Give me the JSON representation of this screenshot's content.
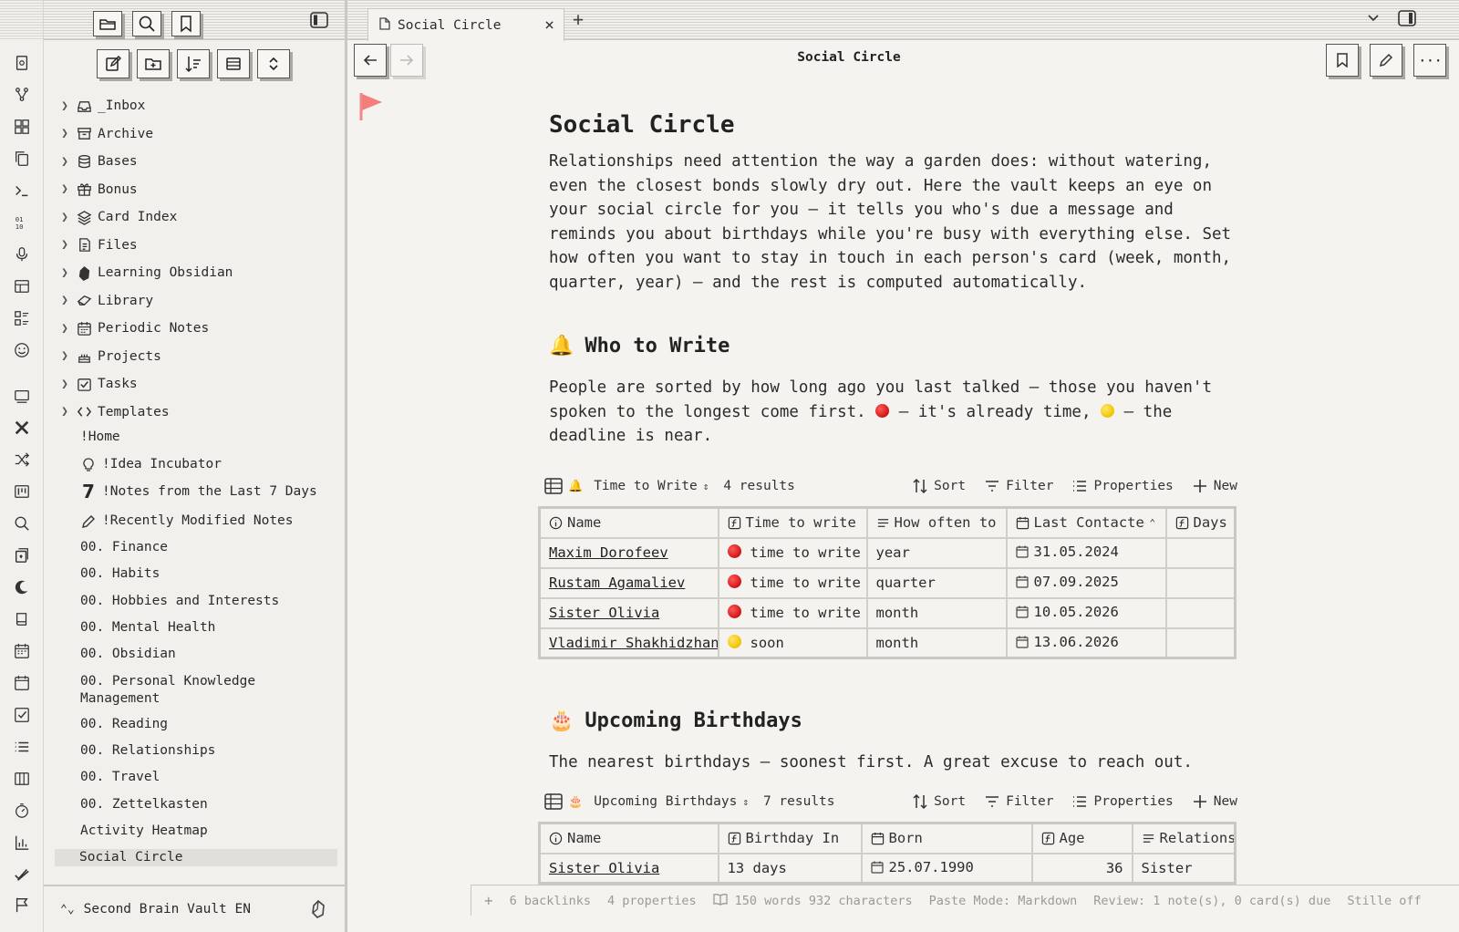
{
  "sidebar": {
    "tree": [
      {
        "label": "_Inbox",
        "icon": "inbox-icon"
      },
      {
        "label": "Archive",
        "icon": "archive-icon"
      },
      {
        "label": "Bases",
        "icon": "database-icon"
      },
      {
        "label": "Bonus",
        "icon": "gift-icon"
      },
      {
        "label": "Card Index",
        "icon": "layers-icon"
      },
      {
        "label": "Files",
        "icon": "files-icon"
      },
      {
        "label": "Learning Obsidian",
        "icon": "obsidian-icon"
      },
      {
        "label": "Library",
        "icon": "book-icon"
      },
      {
        "label": "Periodic Notes",
        "icon": "calendar-icon"
      },
      {
        "label": "Projects",
        "icon": "cake-icon"
      },
      {
        "label": "Tasks",
        "icon": "checkbox-icon"
      },
      {
        "label": "Templates",
        "icon": "code-icon"
      }
    ],
    "home": "!Home",
    "idea": "!Idea Incubator",
    "seven": "7",
    "notes7": "!Notes from the Last 7 Days",
    "recent": "!Recently Modified Notes",
    "files": [
      "00. Finance",
      "00. Habits",
      "00. Hobbies and Interests",
      "00. Mental Health",
      "00. Obsidian",
      "00. Personal Knowledge Management",
      "00. Reading",
      "00. Relationships",
      "00. Travel",
      "00. Zettelkasten",
      "Activity Heatmap",
      "Social Circle"
    ],
    "vault": "Second Brain Vault EN"
  },
  "tab": {
    "label": "Social Circle",
    "close": "×",
    "new": "+"
  },
  "view_title": "Social Circle",
  "note": {
    "title": "Social Circle",
    "intro": "Relationships need attention the way a garden does: without watering, even the closest bonds slowly dry out. Here the vault keeps an eye on your social circle for you — it tells you who's due a message and reminds you about birthdays while you're busy with everything else. Set how often you want to stay in touch in each person's card (week, month, quarter, year) — and the rest is computed automatically.",
    "sec1": {
      "emoji": "🔔",
      "title": "Who to Write"
    },
    "sec1_text_a": "People are sorted by how long ago you last talked — those you haven't spoken to the longest come first.",
    "sec1_text_b": "— it's already time,",
    "sec1_text_c": "— the deadline is near.",
    "sec2": {
      "emoji": "🎂",
      "title": "Upcoming Birthdays"
    },
    "sec2_text": "The nearest birthdays — soonest first. A great excuse to reach out."
  },
  "base1": {
    "view": "Time to Write",
    "emoji": "🔔",
    "results": "4 results",
    "sort": "Sort",
    "filter": "Filter",
    "properties": "Properties",
    "new": "New",
    "headers": [
      "Name",
      "Time to write",
      "How often to keep in touch",
      "Last Contacted",
      "Days"
    ],
    "rows": [
      {
        "name": "Maxim Dorofeev",
        "status": "red",
        "text": "time to write",
        "freq": "year",
        "date": "31.05.2024"
      },
      {
        "name": "Rustam Agamaliev",
        "status": "red",
        "text": "time to write",
        "freq": "quarter",
        "date": "07.09.2025"
      },
      {
        "name": "Sister Olivia",
        "status": "red",
        "text": "time to write",
        "freq": "month",
        "date": "10.05.2026"
      },
      {
        "name": "Vladimir Shakhidzhanyan",
        "status": "yellow",
        "text": "soon",
        "freq": "month",
        "date": "13.06.2026"
      }
    ]
  },
  "base2": {
    "view": "Upcoming Birthdays",
    "emoji": "🎂",
    "results": "7 results",
    "sort": "Sort",
    "filter": "Filter",
    "properties": "Properties",
    "new": "New",
    "headers": [
      "Name",
      "Birthday In",
      "Born",
      "Age",
      "Relations"
    ],
    "rows": [
      {
        "name": "Sister Olivia",
        "in": "13 days",
        "born": "25.07.1990",
        "age": "36",
        "rel": "Sister"
      }
    ]
  },
  "status": {
    "backlinks": "6 backlinks",
    "properties": "4 properties",
    "words": "150 words 932 characters",
    "paste": "Paste Mode: Markdown",
    "review": "Review: 1 note(s), 0 card(s) due",
    "stille": "Stille off"
  }
}
